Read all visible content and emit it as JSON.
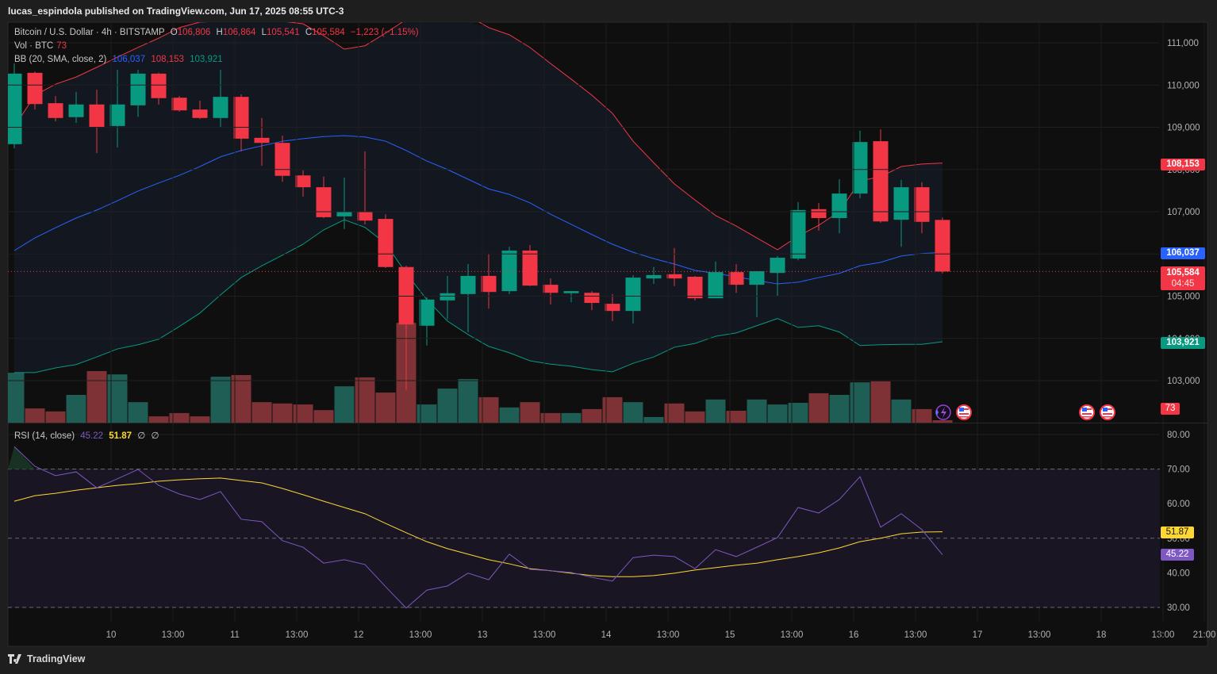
{
  "header": {
    "published": "lucas_espindola published on TradingView.com, Jun 17, 2025 08:55 UTC-3"
  },
  "legend": {
    "symbol": "Bitcoin / U.S. Dollar · 4h · BITSTAMP",
    "o_label": "O",
    "o": "106,806",
    "h_label": "H",
    "h": "106,864",
    "l_label": "L",
    "l": "105,541",
    "c_label": "C",
    "c": "105,584",
    "change": "−1,223 (−1.15%)",
    "vol_label": "Vol · BTC",
    "vol": "73",
    "bb_label": "BB (20, SMA, close, 2)",
    "bb_mid": "106,037",
    "bb_upper": "108,153",
    "bb_lower": "103,921",
    "rsi_label": "RSI (14, close)",
    "rsi": "45.22",
    "rsi_ma": "51.87",
    "rsi_x1": "∅",
    "rsi_x2": "∅"
  },
  "price_tags": {
    "upper": "108,153",
    "mid": "106,037",
    "last": "105,584",
    "countdown": "04:45",
    "lower": "103,921",
    "volume": "73",
    "rsi_ma": "51.87",
    "rsi": "45.22"
  },
  "footer": {
    "brand": "TradingView"
  },
  "colors": {
    "up": "#089981",
    "down": "#f23645",
    "bb_mid": "#2962ff",
    "bb_upper": "#f23645",
    "bb_lower": "#089981",
    "rsi": "#7e57c2",
    "rsi_ma": "#fdd835"
  },
  "chart_data": {
    "type": "candlestick",
    "title": "Bitcoin / U.S. Dollar · 4h · BITSTAMP",
    "ylim": [
      102500,
      111500
    ],
    "price_ticks": [
      "111,000",
      "110,000",
      "109,000",
      "108,000",
      "107,000",
      "106,000",
      "105,000",
      "104,000",
      "103,000"
    ],
    "price_tick_values": [
      111000,
      110000,
      109000,
      108000,
      107000,
      106000,
      105000,
      104000,
      103000
    ],
    "time_ticks": [
      {
        "label": "10",
        "bar": 2
      },
      {
        "label": "13:00",
        "bar": 5
      },
      {
        "label": "11",
        "bar": 8
      },
      {
        "label": "13:00",
        "bar": 11
      },
      {
        "label": "12",
        "bar": 14
      },
      {
        "label": "13:00",
        "bar": 17
      },
      {
        "label": "13",
        "bar": 20
      },
      {
        "label": "13:00",
        "bar": 23
      },
      {
        "label": "14",
        "bar": 26
      },
      {
        "label": "13:00",
        "bar": 29
      },
      {
        "label": "15",
        "bar": 32
      },
      {
        "label": "13:00",
        "bar": 35
      },
      {
        "label": "16",
        "bar": 38
      },
      {
        "label": "13:00",
        "bar": 41
      },
      {
        "label": "17",
        "bar": 44
      },
      {
        "label": "13:00",
        "bar": 47
      },
      {
        "label": "18",
        "bar": 50
      },
      {
        "label": "13:00",
        "bar": 53
      },
      {
        "label": "21:00",
        "bar": 55
      }
    ],
    "ohlc": [
      [
        108600,
        110510,
        108500,
        110270
      ],
      [
        110290,
        110320,
        109420,
        109550
      ],
      [
        109570,
        109740,
        109140,
        109220
      ],
      [
        109240,
        109840,
        109100,
        109540
      ],
      [
        109540,
        109890,
        108390,
        108990
      ],
      [
        109030,
        110360,
        108520,
        109540
      ],
      [
        109520,
        110360,
        109250,
        110270
      ],
      [
        110270,
        110290,
        109540,
        109690
      ],
      [
        109700,
        109740,
        109370,
        109400
      ],
      [
        109420,
        109630,
        109200,
        109220
      ],
      [
        109220,
        110360,
        109010,
        109720
      ],
      [
        109720,
        109780,
        108430,
        108730
      ],
      [
        108750,
        109220,
        108090,
        108630
      ],
      [
        108630,
        108800,
        107710,
        107850
      ],
      [
        107860,
        107980,
        107360,
        107580
      ],
      [
        107580,
        107830,
        106850,
        106870
      ],
      [
        106890,
        107810,
        106590,
        107000
      ],
      [
        107000,
        108430,
        106700,
        106790
      ],
      [
        106830,
        106940,
        105670,
        105690
      ],
      [
        105690,
        105720,
        102770,
        104330
      ],
      [
        104300,
        104970,
        103830,
        104920
      ],
      [
        104900,
        105480,
        104450,
        105070
      ],
      [
        105050,
        105760,
        104150,
        105480
      ],
      [
        105480,
        106010,
        104710,
        105100
      ],
      [
        105120,
        106170,
        105050,
        106080
      ],
      [
        106080,
        106210,
        105240,
        105250
      ],
      [
        105270,
        105420,
        104800,
        105080
      ],
      [
        105070,
        105120,
        104860,
        105120
      ],
      [
        105080,
        105120,
        104670,
        104840
      ],
      [
        104820,
        105050,
        104410,
        104650
      ],
      [
        104650,
        105500,
        104350,
        105440
      ],
      [
        105420,
        105690,
        105290,
        105500
      ],
      [
        105520,
        106140,
        105240,
        105420
      ],
      [
        105460,
        105480,
        104900,
        104950
      ],
      [
        104950,
        105820,
        104950,
        105570
      ],
      [
        105570,
        105760,
        105080,
        105270
      ],
      [
        105270,
        105590,
        104500,
        105590
      ],
      [
        105550,
        105950,
        104990,
        105910
      ],
      [
        105890,
        107230,
        105850,
        107040
      ],
      [
        107060,
        107210,
        106550,
        106850
      ],
      [
        106850,
        107770,
        106490,
        107430
      ],
      [
        107430,
        108920,
        107320,
        108650
      ],
      [
        108670,
        108950,
        106740,
        106770
      ],
      [
        106810,
        107750,
        106170,
        107580
      ],
      [
        107580,
        107700,
        106490,
        106760
      ],
      [
        106806,
        106864,
        105541,
        105584
      ]
    ],
    "volume": [
      1510,
      430,
      340,
      840,
      1560,
      1460,
      620,
      190,
      290,
      190,
      1390,
      1440,
      620,
      580,
      550,
      380,
      1100,
      1370,
      910,
      3020,
      550,
      1030,
      1320,
      770,
      460,
      620,
      290,
      290,
      410,
      770,
      620,
      170,
      580,
      340,
      700,
      360,
      700,
      550,
      600,
      890,
      840,
      1220,
      1250,
      700,
      410,
      73
    ],
    "bb_upper": [
      109010,
      109760,
      110020,
      110190,
      110420,
      110660,
      110890,
      111110,
      111360,
      111490,
      111510,
      111510,
      111510,
      111510,
      111450,
      111170,
      110850,
      110930,
      111230,
      111550,
      111830,
      111920,
      111640,
      111360,
      111190,
      110890,
      110510,
      110140,
      109760,
      109330,
      108670,
      108160,
      107660,
      107280,
      106910,
      106660,
      106380,
      106100,
      106420,
      106680,
      107000,
      107730,
      107830,
      108070,
      108130,
      108153
    ],
    "bb_mid": [
      106080,
      106380,
      106620,
      106850,
      107040,
      107260,
      107490,
      107680,
      107860,
      108070,
      108300,
      108450,
      108560,
      108670,
      108730,
      108780,
      108800,
      108770,
      108670,
      108450,
      108200,
      108000,
      107770,
      107540,
      107410,
      107210,
      106940,
      106700,
      106460,
      106230,
      106040,
      105890,
      105760,
      105610,
      105540,
      105460,
      105370,
      105290,
      105330,
      105440,
      105540,
      105720,
      105800,
      105950,
      106010,
      106037
    ],
    "bb_lower": [
      103190,
      103190,
      103300,
      103380,
      103560,
      103750,
      103850,
      103980,
      104280,
      104600,
      105030,
      105440,
      105720,
      105970,
      106230,
      106570,
      106810,
      106630,
      106250,
      105540,
      104920,
      104410,
      104090,
      103810,
      103660,
      103470,
      103390,
      103340,
      103260,
      103210,
      103410,
      103560,
      103790,
      103880,
      104050,
      104130,
      104300,
      104470,
      104260,
      104300,
      104150,
      103830,
      103850,
      103860,
      103860,
      103921
    ],
    "rsi": [
      76.5,
      70.8,
      68.1,
      69.2,
      64.6,
      67.2,
      69.9,
      65.3,
      62.8,
      61.2,
      63.5,
      55.5,
      54.8,
      49.3,
      47.4,
      42.8,
      43.8,
      42.4,
      36.0,
      29.8,
      35.0,
      36.2,
      39.9,
      38.0,
      45.4,
      41.0,
      40.6,
      40.1,
      38.7,
      37.6,
      44.4,
      45.1,
      44.7,
      41.2,
      46.7,
      44.7,
      47.4,
      50.2,
      58.9,
      57.3,
      61.2,
      67.8,
      53.2,
      57.1,
      52.5,
      45.22
    ],
    "rsi_ma": [
      60.7,
      62.3,
      63.0,
      63.9,
      64.6,
      65.3,
      65.8,
      66.5,
      66.9,
      67.2,
      67.4,
      66.7,
      66.0,
      64.4,
      62.6,
      60.7,
      58.9,
      57.1,
      54.3,
      51.6,
      49.0,
      47.0,
      45.4,
      43.8,
      42.6,
      41.2,
      40.6,
      39.9,
      39.2,
      38.9,
      38.9,
      39.2,
      39.9,
      40.8,
      41.5,
      42.2,
      42.8,
      43.8,
      44.7,
      45.8,
      47.2,
      49.0,
      50.0,
      51.3,
      51.8,
      51.87
    ],
    "rsi_ticks": [
      "80.00",
      "70.00",
      "60.00",
      "50.00",
      "40.00",
      "30.00"
    ],
    "rsi_tick_values": [
      80,
      70,
      60,
      50,
      40,
      30
    ],
    "rsi_ylim": [
      30,
      80
    ]
  }
}
